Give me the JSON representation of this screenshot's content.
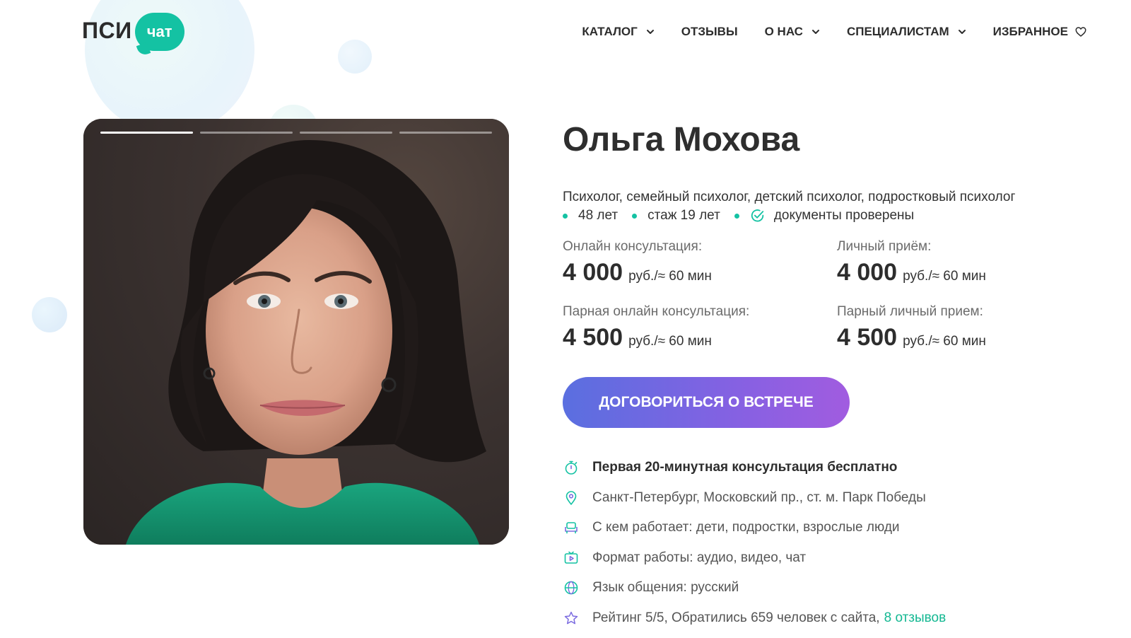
{
  "logo": {
    "text": "ПСИ",
    "bubble": "чат"
  },
  "nav": {
    "items": [
      {
        "label": "КАТАЛОГ",
        "icon": "chevron-down-icon"
      },
      {
        "label": "ОТЗЫВЫ"
      },
      {
        "label": "О НАС",
        "icon": "chevron-down-icon"
      },
      {
        "label": "СПЕЦИАЛИСТАМ",
        "icon": "chevron-down-icon"
      },
      {
        "label": "ИЗБРАННОЕ",
        "icon": "heart-icon"
      }
    ]
  },
  "gallery": {
    "total": 4,
    "active": 1
  },
  "profile": {
    "name": "Ольга Мохова",
    "specialization": "Психолог, семейный психолог, детский психолог, подростковый психолог",
    "age": "48 лет",
    "experience": "стаж 19 лет",
    "documents": "документы проверены"
  },
  "prices": [
    {
      "label": "Онлайн консультация:",
      "amount": "4 000",
      "unit": "руб./≈ 60 мин"
    },
    {
      "label": "Личный приём:",
      "amount": "4 000",
      "unit": "руб./≈ 60 мин"
    },
    {
      "label": "Парная онлайн консультация:",
      "amount": "4 500",
      "unit": "руб./≈ 60 мин"
    },
    {
      "label": "Парный личный прием:",
      "amount": "4 500",
      "unit": "руб./≈ 60 мин"
    }
  ],
  "cta": {
    "label": "ДОГОВОРИТЬСЯ О ВСТРЕЧЕ"
  },
  "features": [
    {
      "icon": "stopwatch-icon",
      "text": "Первая 20-минутная консультация бесплатно"
    },
    {
      "icon": "location-pin-icon",
      "text": "Санкт-Петербург, Московский пр., ст. м. Парк Победы"
    },
    {
      "icon": "armchair-icon",
      "text": "С кем работает: дети, подростки, взрослые люди"
    },
    {
      "icon": "video-play-icon",
      "text": "Формат работы: аудио, видео, чат"
    },
    {
      "icon": "globe-icon",
      "text": "Язык общения: русский"
    },
    {
      "icon": "star-icon",
      "text": "Рейтинг 5/5, Обратились 659 человек с сайта,",
      "link": "8 отзывов"
    }
  ],
  "colors": {
    "accent": "#14c2a3",
    "cta_start": "#5a6fe0",
    "cta_end": "#a15ce0",
    "text": "#2d2d2d",
    "muted": "#6b6b6b"
  }
}
